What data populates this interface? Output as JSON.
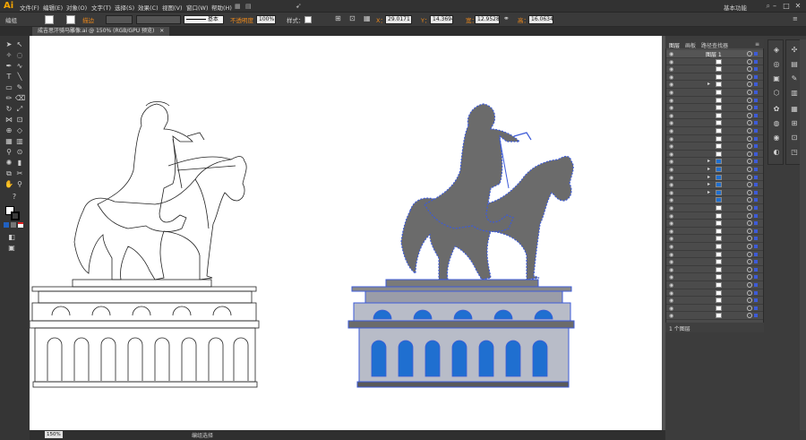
{
  "app": {
    "logo": "Ai",
    "workspace": "基本功能"
  },
  "menu": [
    "文件(F)",
    "编辑(E)",
    "对象(O)",
    "文字(T)",
    "选择(S)",
    "效果(C)",
    "视图(V)",
    "窗口(W)",
    "帮助(H)"
  ],
  "control": {
    "mode_label": "编组",
    "stroke_label": "描边",
    "stroke_style": "基本",
    "opacity_label": "不透明度",
    "opacity_value": "100%",
    "style_label": "样式：",
    "x_label": "X：",
    "x_value": "29.0171",
    "y_label": "Y：",
    "y_value": "14.3694",
    "w_label": "宽：",
    "w_value": "12.9528",
    "h_label": "高：",
    "h_value": "16.0634"
  },
  "document_tab": "成吉思汗骑马雕像.ai @ 150% (RGB/GPU 预览)",
  "status": {
    "zoom": "150%",
    "tool": "编组选择"
  },
  "layers_panel": {
    "tabs": [
      "图层",
      "画板",
      "路径查找器"
    ],
    "top_layer": "图层 1",
    "layer_count": "1 个图层"
  },
  "colors": {
    "accent": "#f08a1a",
    "selection": "#3d5bd8",
    "statue_fill": "#6b6b6b"
  }
}
